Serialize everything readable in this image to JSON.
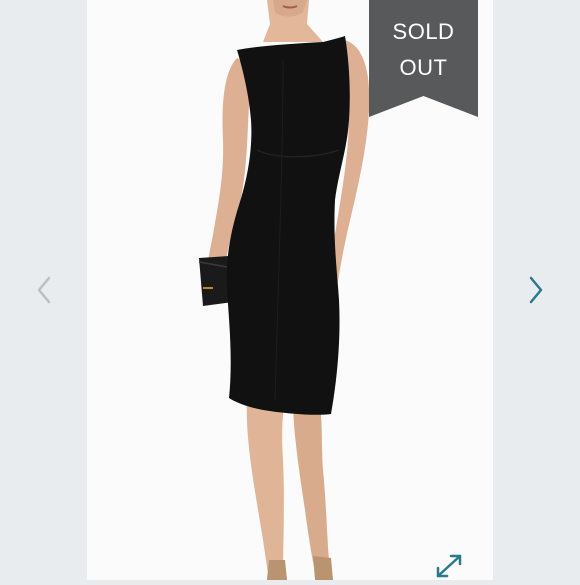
{
  "listing": {
    "badge": {
      "line1": "SOLD",
      "line2": "OUT"
    }
  },
  "icons": {
    "prev": "chevron-left-icon",
    "next": "chevron-right-icon",
    "expand": "expand-icon"
  },
  "colors": {
    "background": "#e8ecef",
    "badge": "#58595b",
    "next_arrow": "#2b7a8c",
    "prev_arrow": "#b9bfc4",
    "dress": "#111111"
  }
}
